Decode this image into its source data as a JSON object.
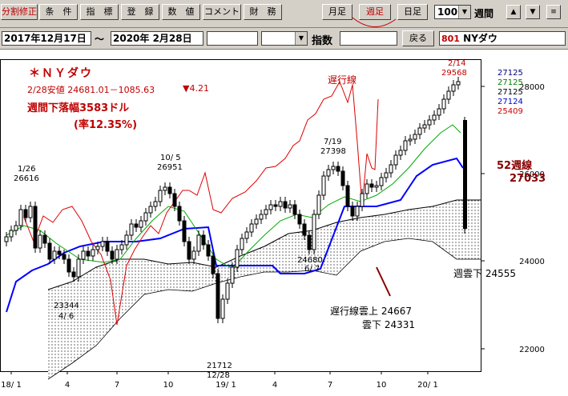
{
  "toolbar": {
    "buttons": [
      "分割修正",
      "条　件",
      "指　標",
      "登　録",
      "数　値",
      "コメント",
      "財　務"
    ],
    "period_buttons": [
      "月足",
      "週足",
      "日足"
    ],
    "count_value": "100",
    "period_label": "週間",
    "nav_icons": [
      "▲",
      "▼",
      "≡"
    ]
  },
  "datebar": {
    "start_date": "2017年12月17日",
    "separator": "～",
    "end_date": "2020年 2月28日",
    "index_label": "指数",
    "back_button": "戻る",
    "code": "801",
    "name": "NYダウ"
  },
  "annotations": {
    "title": "＊ＮＹダウ",
    "info_line": "2/28安値 24681.01－1085.63",
    "info_change": "▼4.21",
    "weekly_drop": "週間下落幅3583ドル",
    "weekly_drop_pct": "(率12.35%)",
    "chikou_label": "遅行線",
    "ma52_label": "52週線",
    "ma52_value": "27033",
    "peak_date": "2/14",
    "peak_value": "29568",
    "legend_values": [
      "27125",
      "27125",
      "27125",
      "27124",
      "25409"
    ],
    "legend_colors": [
      "#000080",
      "#008000",
      "#000000",
      "#0000cc",
      "#cc0000"
    ],
    "cloud_under": "週雲下  24555",
    "chikou_cloud_top": "遅行線雲上  24667",
    "chikou_cloud_bottom": "雲下  24331",
    "labels": [
      {
        "date": "1/26",
        "value": "26616"
      },
      {
        "date": "10/ 5",
        "value": "26951"
      },
      {
        "date": "7/19",
        "value": "27398"
      },
      {
        "date": "4/ 6",
        "value": "23344"
      },
      {
        "date": "12/28",
        "value": "21712"
      },
      {
        "date": "6/ 7",
        "value": "24680"
      }
    ]
  },
  "chart_data": {
    "type": "candlestick",
    "y_ticks": [
      "28000",
      "26000",
      "24000",
      "22000"
    ],
    "x_ticks": [
      "18/ 1",
      "4",
      "7",
      "10",
      "19/ 1",
      "4",
      "7",
      "10",
      "20/ 1"
    ],
    "colors": {
      "ma52": "#0000ff",
      "ma13": "#00aa00",
      "chikou": "#dd0000",
      "cloud_edge": "#000000",
      "candle": "#000000"
    }
  }
}
